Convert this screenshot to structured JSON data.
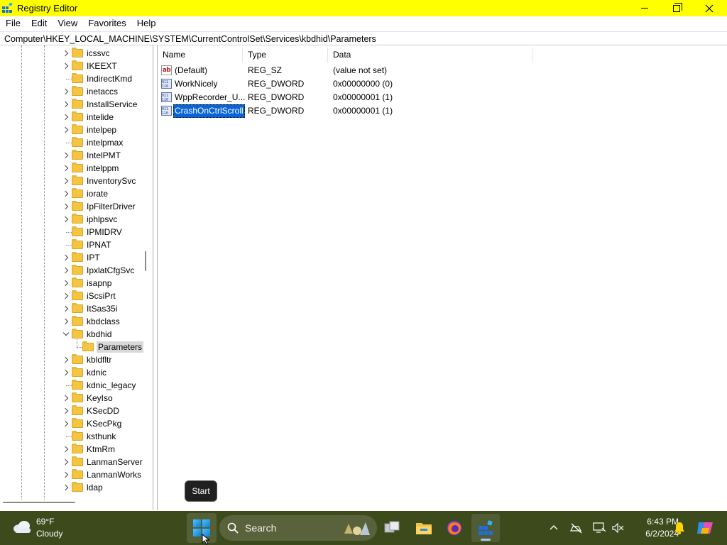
{
  "window": {
    "title": "Registry Editor",
    "title_bar_color": "#ffff00"
  },
  "menu": [
    "File",
    "Edit",
    "View",
    "Favorites",
    "Help"
  ],
  "address": "Computer\\HKEY_LOCAL_MACHINE\\SYSTEM\\CurrentControlSet\\Services\\kbdhid\\Parameters",
  "tree": {
    "items": [
      {
        "label": "icssvc",
        "expander": "collapsed"
      },
      {
        "label": "IKEEXT",
        "expander": "collapsed"
      },
      {
        "label": "IndirectKmd",
        "expander": "none"
      },
      {
        "label": "inetaccs",
        "expander": "collapsed"
      },
      {
        "label": "InstallService",
        "expander": "collapsed"
      },
      {
        "label": "intelide",
        "expander": "collapsed"
      },
      {
        "label": "intelpep",
        "expander": "collapsed"
      },
      {
        "label": "intelpmax",
        "expander": "none"
      },
      {
        "label": "IntelPMT",
        "expander": "collapsed"
      },
      {
        "label": "intelppm",
        "expander": "collapsed"
      },
      {
        "label": "InventorySvc",
        "expander": "collapsed"
      },
      {
        "label": "iorate",
        "expander": "collapsed"
      },
      {
        "label": "IpFilterDriver",
        "expander": "collapsed"
      },
      {
        "label": "iphlpsvc",
        "expander": "collapsed"
      },
      {
        "label": "IPMIDRV",
        "expander": "none"
      },
      {
        "label": "IPNAT",
        "expander": "none"
      },
      {
        "label": "IPT",
        "expander": "collapsed"
      },
      {
        "label": "IpxlatCfgSvc",
        "expander": "collapsed"
      },
      {
        "label": "isapnp",
        "expander": "collapsed"
      },
      {
        "label": "iScsiPrt",
        "expander": "collapsed"
      },
      {
        "label": "ItSas35i",
        "expander": "collapsed"
      },
      {
        "label": "kbdclass",
        "expander": "collapsed"
      },
      {
        "label": "kbdhid",
        "expander": "expanded"
      },
      {
        "label": "Parameters",
        "expander": "child",
        "selected": true
      },
      {
        "label": "kbldfltr",
        "expander": "collapsed"
      },
      {
        "label": "kdnic",
        "expander": "collapsed"
      },
      {
        "label": "kdnic_legacy",
        "expander": "none"
      },
      {
        "label": "KeyIso",
        "expander": "collapsed"
      },
      {
        "label": "KSecDD",
        "expander": "collapsed"
      },
      {
        "label": "KSecPkg",
        "expander": "collapsed"
      },
      {
        "label": "ksthunk",
        "expander": "none"
      },
      {
        "label": "KtmRm",
        "expander": "collapsed"
      },
      {
        "label": "LanmanServer",
        "expander": "collapsed"
      },
      {
        "label": "LanmanWorks",
        "expander": "collapsed"
      },
      {
        "label": "ldap",
        "expander": "collapsed"
      }
    ]
  },
  "list": {
    "columns": [
      "Name",
      "Type",
      "Data"
    ],
    "rows": [
      {
        "icon": "string-value-icon",
        "name": "(Default)",
        "type": "REG_SZ",
        "data": "(value not set)",
        "selected": false
      },
      {
        "icon": "dword-value-icon",
        "name": "WorkNicely",
        "type": "REG_DWORD",
        "data": "0x00000000 (0)",
        "selected": false
      },
      {
        "icon": "dword-value-icon",
        "name": "WppRecorder_U...",
        "type": "REG_DWORD",
        "data": "0x00000001 (1)",
        "selected": false
      },
      {
        "icon": "dword-value-icon",
        "name": "CrashOnCtrlScroll",
        "type": "REG_DWORD",
        "data": "0x00000001 (1)",
        "selected": true
      }
    ]
  },
  "tooltip": "Start",
  "taskbar": {
    "weather_temp": "69°F",
    "weather_desc": "Cloudy",
    "search_placeholder": "Search",
    "clock_time": "6:43 PM",
    "clock_date": "6/2/2024",
    "background": "#3d4a1c"
  }
}
